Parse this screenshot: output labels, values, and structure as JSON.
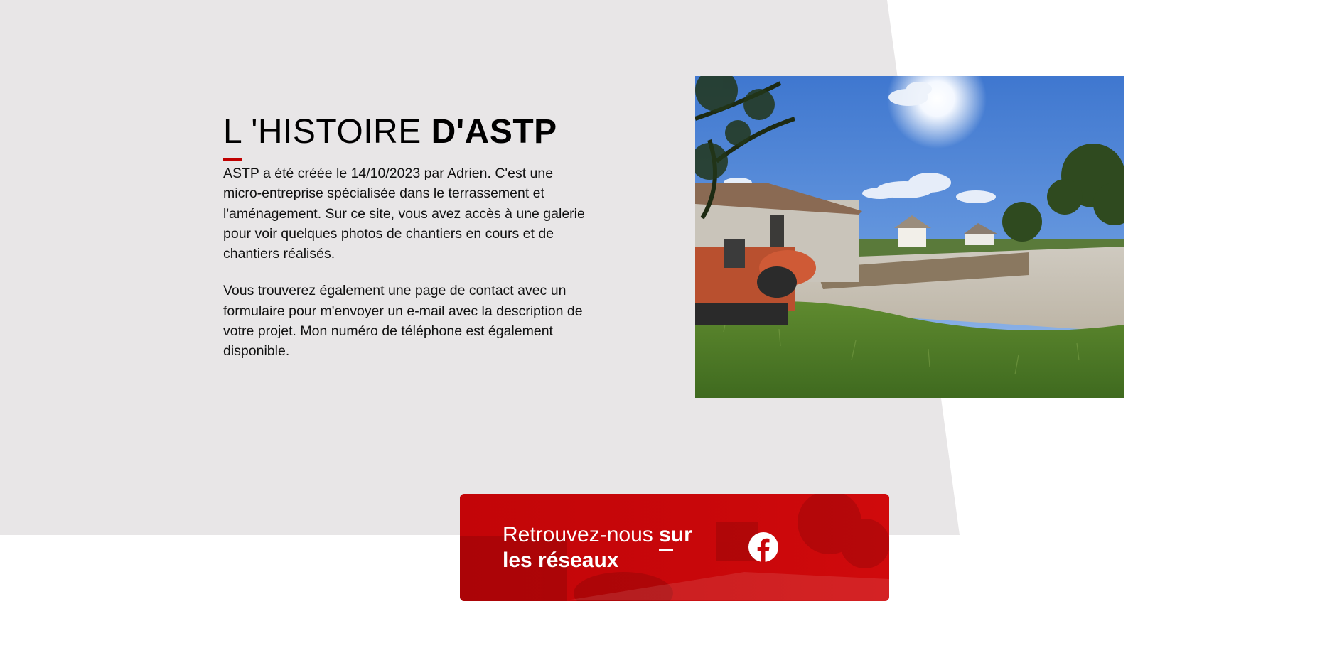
{
  "history": {
    "title_light": "L 'HISTOIRE",
    "title_bold": "D'ASTP",
    "paragraphs": [
      "ASTP a été créée le 14/10/2023 par Adrien. C'est une micro-entreprise spécialisée dans le terrassement et l'aménagement. Sur ce site, vous avez accès à une galerie pour voir quelques photos de chantiers en cours et de chantiers réalisés.",
      "Vous trouverez également une page de contact avec un formulaire pour m'envoyer un e-mail avec la description de votre projet. Mon numéro de téléphone est également disponible."
    ]
  },
  "photo": {
    "subject": "construction-site-with-mini-excavator"
  },
  "social": {
    "text_normal": "Retrouvez-nous",
    "text_bold_1": "sur",
    "text_bold_2": "les réseaux",
    "icon": "facebook-icon"
  },
  "colors": {
    "accent": "#c00000",
    "panel_bg": "#e8e6e7",
    "banner_red": "#c8070a"
  }
}
